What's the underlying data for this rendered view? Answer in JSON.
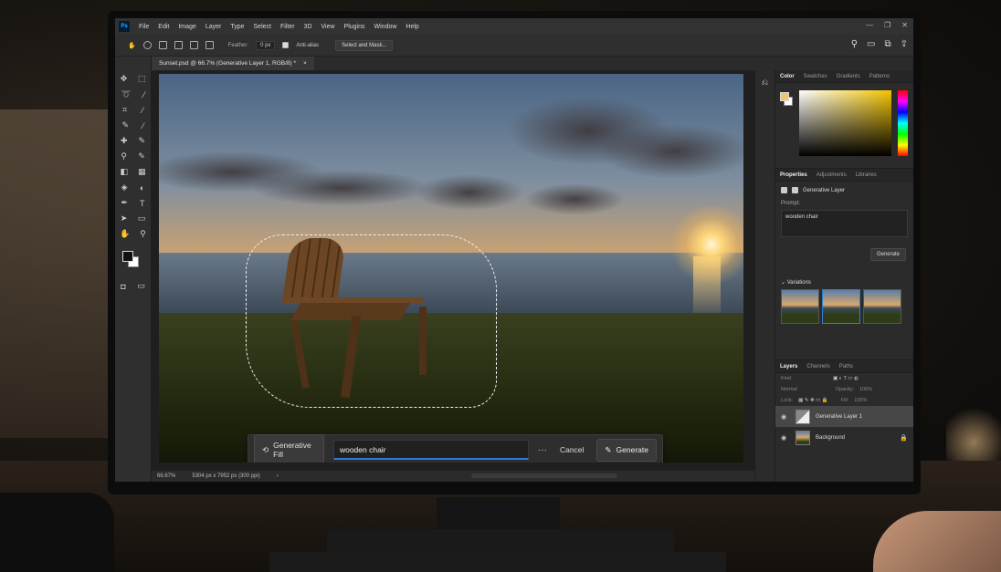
{
  "app": {
    "logo": "Ps",
    "menu": [
      "File",
      "Edit",
      "Image",
      "Layer",
      "Type",
      "Select",
      "Filter",
      "3D",
      "View",
      "Plugins",
      "Window",
      "Help"
    ],
    "window_controls": [
      "—",
      "❐",
      "✕"
    ]
  },
  "options_bar": {
    "feather_label": "Feather:",
    "feather_value": "0 px",
    "antialias_label": "Anti-alias",
    "select_mask_label": "Select and Mask..."
  },
  "document": {
    "tab_title": "Sunset.psd @ 66.7% (Generative Layer 1, RGB/8) *",
    "tab_close": "×",
    "zoom": "66.67%",
    "doc_info": "5304 px x 7952 px (300 ppi)"
  },
  "generative_bar": {
    "gen_fill_label": "Generative Fill",
    "prompt_value": "wooden chair",
    "more": "···",
    "cancel_label": "Cancel",
    "generate_label": "Generate"
  },
  "color_panel": {
    "tabs": [
      "Color",
      "Swatches",
      "Gradients",
      "Patterns"
    ],
    "foreground": "#f2c66a",
    "background": "#ffffff"
  },
  "properties_panel": {
    "tabs": [
      "Properties",
      "Adjustments",
      "Libraries"
    ],
    "layer_type": "Generative Layer",
    "prompt_label": "Prompt:",
    "prompt_value": "wooden chair",
    "generate_label": "Generate",
    "variations_label": "Variations"
  },
  "layers_panel": {
    "tabs": [
      "Layers",
      "Channels",
      "Paths"
    ],
    "kind_filter": "Kind",
    "blend_mode": "Normal",
    "opacity_label": "Opacity:",
    "opacity_value": "100%",
    "lock_label": "Lock:",
    "fill_label": "Fill:",
    "fill_value": "100%",
    "layers": [
      {
        "name": "Generative Layer 1"
      },
      {
        "name": "Background"
      }
    ]
  },
  "accent": "#2d7ed6"
}
